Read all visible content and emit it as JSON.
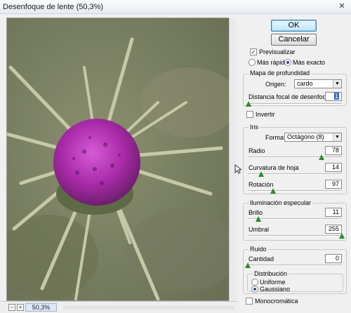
{
  "window": {
    "title": "Desenfoque de lente (50,3%)"
  },
  "buttons": {
    "ok": "OK",
    "cancel": "Cancelar"
  },
  "preview": {
    "label": "Previsualizar",
    "checked": true,
    "fast": "Más rápido",
    "exact": "Más exacto",
    "mode": "exact"
  },
  "zoom": {
    "minus": "−",
    "plus": "+",
    "value": "50,3%"
  },
  "depth_map": {
    "title": "Mapa de profundidad",
    "origin_label": "Origen:",
    "origin_value": "cardo",
    "focal_label": "Distancia focal de desenfoque",
    "focal_value": "1",
    "focal_level": 0.01,
    "invert_label": "Invertir",
    "invert_checked": false
  },
  "iris": {
    "title": "Iris",
    "shape_label": "Forma:",
    "shape_value": "Octágono (8)",
    "radius_label": "Radio",
    "radius_value": "78",
    "radius_level": 0.78,
    "curvature_label": "Curvatura de hoja",
    "curvature_value": "14",
    "curvature_level": 0.14,
    "rotation_label": "Rotación",
    "rotation_value": "97",
    "rotation_level": 0.27
  },
  "specular": {
    "title": "Iluminación especular",
    "brightness_label": "Brillo",
    "brightness_value": "11",
    "brightness_level": 0.11,
    "threshold_label": "Umbral",
    "threshold_value": "255",
    "threshold_level": 1.0
  },
  "noise": {
    "title": "Ruido",
    "amount_label": "Cantidad",
    "amount_value": "0",
    "amount_level": 0.0,
    "distribution_title": "Distribución",
    "uniform": "Uniforme",
    "gaussian": "Gaussiano",
    "distribution": "gaussian",
    "mono_label": "Monocromática",
    "mono_checked": false
  },
  "colors": {
    "accent": "#3367d6",
    "thumb": "#2c8a2c",
    "flower": "#b02fb0",
    "background": "#7e8766"
  }
}
